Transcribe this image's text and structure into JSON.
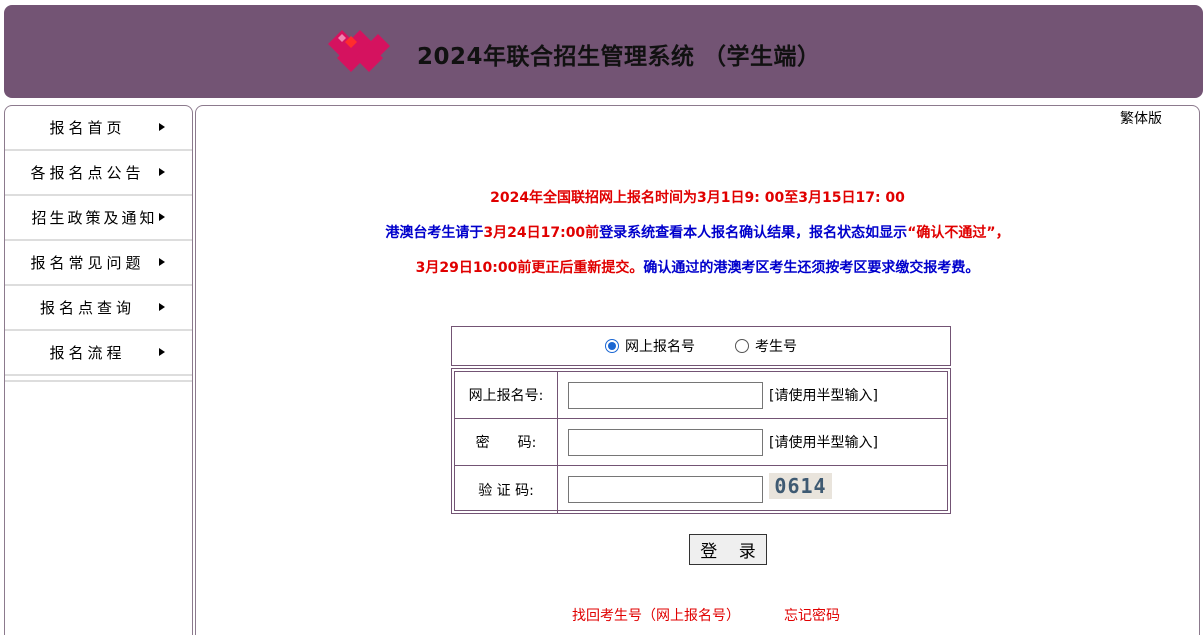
{
  "header": {
    "title": "2024年联合招生管理系统 （学生端）",
    "logo_icon": "diamond-logo-icon",
    "background_color": "#735474",
    "logo_color": "#d5125f"
  },
  "sidebar": {
    "items": [
      {
        "label": "报名首页"
      },
      {
        "label": "各报名点公告"
      },
      {
        "label": "招生政策及通知"
      },
      {
        "label": "报名常见问题"
      },
      {
        "label": "报名点查询"
      },
      {
        "label": "报名流程"
      }
    ]
  },
  "main": {
    "trad_link": "繁体版",
    "notice": {
      "line1": "2024年全国联招网上报名时间为3月1日9: 00至3月15日17: 00",
      "line2_a": "港澳台考生请于",
      "line2_b": "3月24日17:00前",
      "line2_c": "登录系统查看本人报名确认结果，报名状态如显示",
      "line2_d": "“确认不通过”，",
      "line3_a": "3月29日10:00前更正后重新提交。",
      "line3_b": "确认通过的港澳考区考生还须按考区要求缴交报考费。"
    },
    "login_type": {
      "option1": "网上报名号",
      "option2": "考生号",
      "selected": "网上报名号"
    },
    "form": {
      "reg_no_label": "网上报名号:",
      "password_label": "密　　码:",
      "captcha_label": "验 证 码:",
      "hint": "[请使用半型输入]",
      "captcha_value": "0614"
    },
    "login_button": "登 录",
    "links": {
      "find_no": "找回考生号（网上报名号）",
      "forgot_password": "忘记密码"
    }
  },
  "colors": {
    "accent": "#735474",
    "red": "#e00000",
    "blue": "#0000cc"
  }
}
